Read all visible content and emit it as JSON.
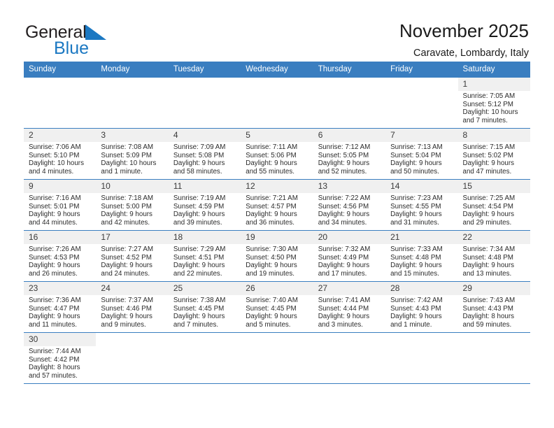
{
  "brand": {
    "name_top": "General",
    "name_bottom": "Blue",
    "accent_color": "#1b78c2"
  },
  "header": {
    "title": "November 2025",
    "subtitle": "Caravate, Lombardy, Italy"
  },
  "calendar": {
    "header_bg": "#3a7ec0",
    "daynum_bg": "#f0f0f0",
    "weekday_headers": [
      "Sunday",
      "Monday",
      "Tuesday",
      "Wednesday",
      "Thursday",
      "Friday",
      "Saturday"
    ],
    "weeks": [
      [
        {
          "day": "",
          "blank": true
        },
        {
          "day": "",
          "blank": true
        },
        {
          "day": "",
          "blank": true
        },
        {
          "day": "",
          "blank": true
        },
        {
          "day": "",
          "blank": true
        },
        {
          "day": "",
          "blank": true
        },
        {
          "day": "1",
          "sunrise": "Sunrise: 7:05 AM",
          "sunset": "Sunset: 5:12 PM",
          "daylight1": "Daylight: 10 hours",
          "daylight2": "and 7 minutes."
        }
      ],
      [
        {
          "day": "2",
          "sunrise": "Sunrise: 7:06 AM",
          "sunset": "Sunset: 5:10 PM",
          "daylight1": "Daylight: 10 hours",
          "daylight2": "and 4 minutes."
        },
        {
          "day": "3",
          "sunrise": "Sunrise: 7:08 AM",
          "sunset": "Sunset: 5:09 PM",
          "daylight1": "Daylight: 10 hours",
          "daylight2": "and 1 minute."
        },
        {
          "day": "4",
          "sunrise": "Sunrise: 7:09 AM",
          "sunset": "Sunset: 5:08 PM",
          "daylight1": "Daylight: 9 hours",
          "daylight2": "and 58 minutes."
        },
        {
          "day": "5",
          "sunrise": "Sunrise: 7:11 AM",
          "sunset": "Sunset: 5:06 PM",
          "daylight1": "Daylight: 9 hours",
          "daylight2": "and 55 minutes."
        },
        {
          "day": "6",
          "sunrise": "Sunrise: 7:12 AM",
          "sunset": "Sunset: 5:05 PM",
          "daylight1": "Daylight: 9 hours",
          "daylight2": "and 52 minutes."
        },
        {
          "day": "7",
          "sunrise": "Sunrise: 7:13 AM",
          "sunset": "Sunset: 5:04 PM",
          "daylight1": "Daylight: 9 hours",
          "daylight2": "and 50 minutes."
        },
        {
          "day": "8",
          "sunrise": "Sunrise: 7:15 AM",
          "sunset": "Sunset: 5:02 PM",
          "daylight1": "Daylight: 9 hours",
          "daylight2": "and 47 minutes."
        }
      ],
      [
        {
          "day": "9",
          "sunrise": "Sunrise: 7:16 AM",
          "sunset": "Sunset: 5:01 PM",
          "daylight1": "Daylight: 9 hours",
          "daylight2": "and 44 minutes."
        },
        {
          "day": "10",
          "sunrise": "Sunrise: 7:18 AM",
          "sunset": "Sunset: 5:00 PM",
          "daylight1": "Daylight: 9 hours",
          "daylight2": "and 42 minutes."
        },
        {
          "day": "11",
          "sunrise": "Sunrise: 7:19 AM",
          "sunset": "Sunset: 4:59 PM",
          "daylight1": "Daylight: 9 hours",
          "daylight2": "and 39 minutes."
        },
        {
          "day": "12",
          "sunrise": "Sunrise: 7:21 AM",
          "sunset": "Sunset: 4:57 PM",
          "daylight1": "Daylight: 9 hours",
          "daylight2": "and 36 minutes."
        },
        {
          "day": "13",
          "sunrise": "Sunrise: 7:22 AM",
          "sunset": "Sunset: 4:56 PM",
          "daylight1": "Daylight: 9 hours",
          "daylight2": "and 34 minutes."
        },
        {
          "day": "14",
          "sunrise": "Sunrise: 7:23 AM",
          "sunset": "Sunset: 4:55 PM",
          "daylight1": "Daylight: 9 hours",
          "daylight2": "and 31 minutes."
        },
        {
          "day": "15",
          "sunrise": "Sunrise: 7:25 AM",
          "sunset": "Sunset: 4:54 PM",
          "daylight1": "Daylight: 9 hours",
          "daylight2": "and 29 minutes."
        }
      ],
      [
        {
          "day": "16",
          "sunrise": "Sunrise: 7:26 AM",
          "sunset": "Sunset: 4:53 PM",
          "daylight1": "Daylight: 9 hours",
          "daylight2": "and 26 minutes."
        },
        {
          "day": "17",
          "sunrise": "Sunrise: 7:27 AM",
          "sunset": "Sunset: 4:52 PM",
          "daylight1": "Daylight: 9 hours",
          "daylight2": "and 24 minutes."
        },
        {
          "day": "18",
          "sunrise": "Sunrise: 7:29 AM",
          "sunset": "Sunset: 4:51 PM",
          "daylight1": "Daylight: 9 hours",
          "daylight2": "and 22 minutes."
        },
        {
          "day": "19",
          "sunrise": "Sunrise: 7:30 AM",
          "sunset": "Sunset: 4:50 PM",
          "daylight1": "Daylight: 9 hours",
          "daylight2": "and 19 minutes."
        },
        {
          "day": "20",
          "sunrise": "Sunrise: 7:32 AM",
          "sunset": "Sunset: 4:49 PM",
          "daylight1": "Daylight: 9 hours",
          "daylight2": "and 17 minutes."
        },
        {
          "day": "21",
          "sunrise": "Sunrise: 7:33 AM",
          "sunset": "Sunset: 4:48 PM",
          "daylight1": "Daylight: 9 hours",
          "daylight2": "and 15 minutes."
        },
        {
          "day": "22",
          "sunrise": "Sunrise: 7:34 AM",
          "sunset": "Sunset: 4:48 PM",
          "daylight1": "Daylight: 9 hours",
          "daylight2": "and 13 minutes."
        }
      ],
      [
        {
          "day": "23",
          "sunrise": "Sunrise: 7:36 AM",
          "sunset": "Sunset: 4:47 PM",
          "daylight1": "Daylight: 9 hours",
          "daylight2": "and 11 minutes."
        },
        {
          "day": "24",
          "sunrise": "Sunrise: 7:37 AM",
          "sunset": "Sunset: 4:46 PM",
          "daylight1": "Daylight: 9 hours",
          "daylight2": "and 9 minutes."
        },
        {
          "day": "25",
          "sunrise": "Sunrise: 7:38 AM",
          "sunset": "Sunset: 4:45 PM",
          "daylight1": "Daylight: 9 hours",
          "daylight2": "and 7 minutes."
        },
        {
          "day": "26",
          "sunrise": "Sunrise: 7:40 AM",
          "sunset": "Sunset: 4:45 PM",
          "daylight1": "Daylight: 9 hours",
          "daylight2": "and 5 minutes."
        },
        {
          "day": "27",
          "sunrise": "Sunrise: 7:41 AM",
          "sunset": "Sunset: 4:44 PM",
          "daylight1": "Daylight: 9 hours",
          "daylight2": "and 3 minutes."
        },
        {
          "day": "28",
          "sunrise": "Sunrise: 7:42 AM",
          "sunset": "Sunset: 4:43 PM",
          "daylight1": "Daylight: 9 hours",
          "daylight2": "and 1 minute."
        },
        {
          "day": "29",
          "sunrise": "Sunrise: 7:43 AM",
          "sunset": "Sunset: 4:43 PM",
          "daylight1": "Daylight: 8 hours",
          "daylight2": "and 59 minutes."
        }
      ],
      [
        {
          "day": "30",
          "sunrise": "Sunrise: 7:44 AM",
          "sunset": "Sunset: 4:42 PM",
          "daylight1": "Daylight: 8 hours",
          "daylight2": "and 57 minutes."
        },
        {
          "day": "",
          "blank": true
        },
        {
          "day": "",
          "blank": true
        },
        {
          "day": "",
          "blank": true
        },
        {
          "day": "",
          "blank": true
        },
        {
          "day": "",
          "blank": true
        },
        {
          "day": "",
          "blank": true
        }
      ]
    ]
  }
}
